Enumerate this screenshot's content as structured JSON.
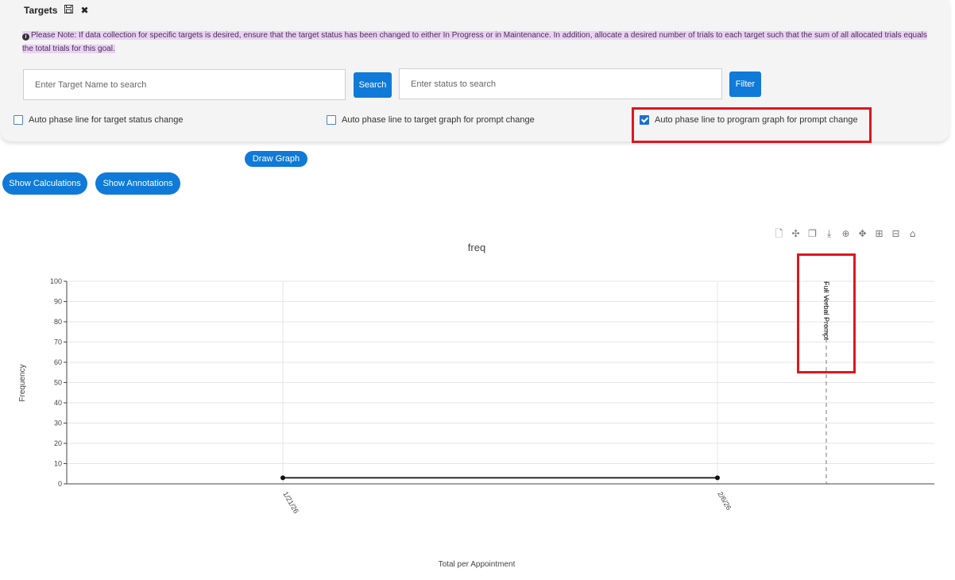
{
  "panel": {
    "title": "Targets",
    "save_icon": "save-icon",
    "close_icon": "close-icon",
    "note": "Please Note: If data collection for specific targets is desired, ensure that the target status has been changed to either In Progress or in Maintenance. In addition, allocate a desired number of trials to each target such that the sum of all allocated trials equals the total trials for this goal.",
    "target_search": {
      "placeholder": "Enter Target Name to search",
      "button": "Search"
    },
    "status_search": {
      "placeholder": "Enter status to search",
      "button": "Filter"
    },
    "checkboxes": [
      {
        "label": "Auto phase line for target status change",
        "checked": false
      },
      {
        "label": "Auto phase line to target graph for prompt change",
        "checked": false
      },
      {
        "label": "Auto phase line to program graph for prompt change",
        "checked": true
      }
    ]
  },
  "buttons": {
    "draw_graph": "Draw Graph",
    "show_calculations": "Show Calculations",
    "show_annotations": "Show Annotations"
  },
  "modebar": [
    "file-icon",
    "spike-lines-icon",
    "compare-icon",
    "download-icon",
    "zoom-icon",
    "pan-icon",
    "zoom-in-icon",
    "zoom-out-icon",
    "home-icon"
  ],
  "colors": {
    "accent": "#0f7ad8",
    "highlight": "#e9d2f3",
    "annotation_box": "#e0161e"
  },
  "chart_data": {
    "type": "line",
    "title": "freq",
    "xlabel": "Total per Appointment",
    "ylabel": "Frequency",
    "ylim": [
      0,
      100
    ],
    "yticks": [
      0,
      10,
      20,
      30,
      40,
      50,
      60,
      70,
      80,
      90,
      100
    ],
    "categories": [
      "1/21/26",
      "2/6/26"
    ],
    "series": [
      {
        "values": [
          3,
          3
        ]
      }
    ],
    "phase_line": {
      "label": "Full Verbal Prompt"
    },
    "grid": true
  }
}
